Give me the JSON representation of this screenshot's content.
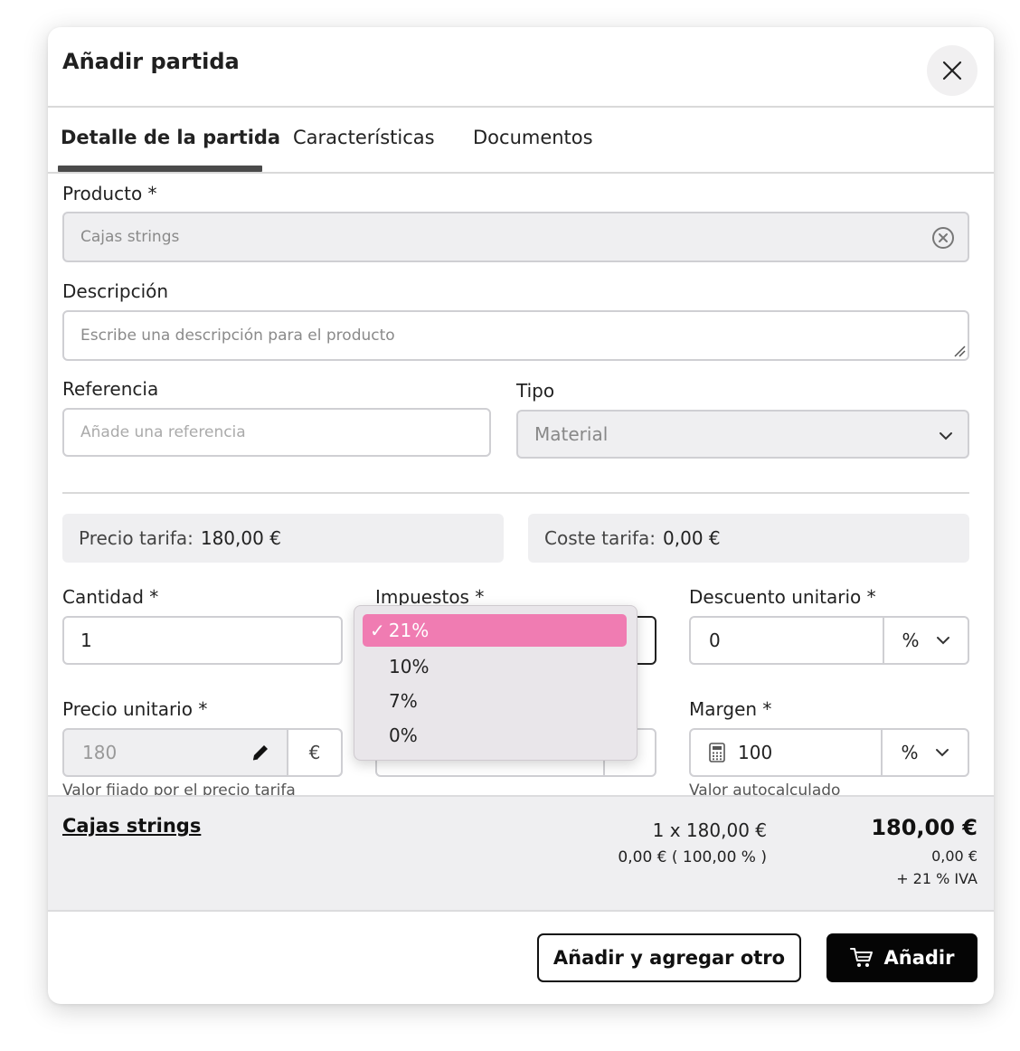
{
  "modal": {
    "title": "Añadir partida",
    "tabs": [
      "Detalle de la partida",
      "Características",
      "Documentos"
    ]
  },
  "product": {
    "label": "Producto *",
    "value": "Cajas strings"
  },
  "description": {
    "label": "Descripción",
    "placeholder": "Escribe una descripción para el producto"
  },
  "reference": {
    "label": "Referencia",
    "placeholder": "Añade una referencia"
  },
  "type": {
    "label": "Tipo",
    "value": "Material"
  },
  "tariff": {
    "price_label": "Precio tarifa:",
    "price_value": "180,00 €",
    "cost_label": "Coste tarifa:",
    "cost_value": "0,00 €"
  },
  "quantity": {
    "label": "Cantidad *",
    "value": "1"
  },
  "taxes": {
    "label": "Impuestos *",
    "options": [
      "21%",
      "10%",
      "7%",
      "0%"
    ],
    "selected": "21%"
  },
  "discount": {
    "label": "Descuento unitario *",
    "value": "0",
    "unit": "%"
  },
  "unit_price": {
    "label": "Precio unitario *",
    "value": "180",
    "currency": "€",
    "helper": "Valor fijado por el precio tarifa"
  },
  "margin": {
    "label": "Margen *",
    "value": "100",
    "unit": "%",
    "helper": "Valor autocalculado"
  },
  "summary": {
    "product_name": "Cajas strings",
    "line1": "1 x 180,00 €",
    "line2": "0,00 € ( 100,00 % )",
    "total": "180,00 €",
    "cost": "0,00 €",
    "tax": "+ 21 % IVA"
  },
  "buttons": {
    "add_another": "Añadir y agregar otro",
    "add": "Añadir"
  },
  "colors": {
    "accent_pink": "#f07cb2",
    "primary_dark": "#050505"
  }
}
